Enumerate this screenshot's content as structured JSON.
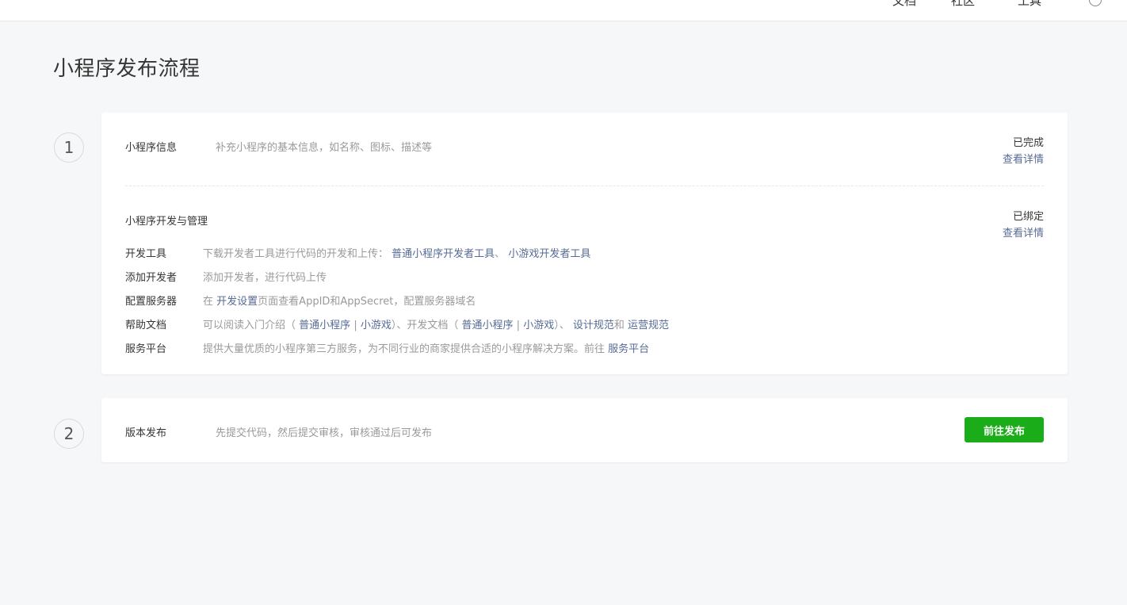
{
  "topbar": {
    "docs": "文档",
    "community": "社区",
    "tools": "工具"
  },
  "page_title": "小程序发布流程",
  "step1": {
    "number": "1",
    "info": {
      "title": "小程序信息",
      "desc": "补充小程序的基本信息，如名称、图标、描述等",
      "status": "已完成",
      "link": "查看详情"
    },
    "dev": {
      "title": "小程序开发与管理",
      "status": "已绑定",
      "link": "查看详情",
      "rows": {
        "tools": {
          "label": "开发工具",
          "desc": "下载开发者工具进行代码的开发和上传：",
          "link1": "普通小程序开发者工具",
          "sep": "、",
          "link2": "小游戏开发者工具"
        },
        "add_dev": {
          "label": "添加开发者",
          "desc": "添加开发者，进行代码上传"
        },
        "server": {
          "label": "配置服务器",
          "pre": "在",
          "link": "开发设置",
          "post": "页面查看AppID和AppSecret，配置服务器域名"
        },
        "help": {
          "label": "帮助文档",
          "pre": "可以阅读入门介绍（",
          "link1": "普通小程序",
          "bar1": "|",
          "link2": "小游戏",
          "mid": "）、开发文档（",
          "link3": "普通小程序",
          "bar2": "|",
          "link4": "小游戏",
          "mid2": "）、",
          "link5": "设计规范",
          "and": "和",
          "link6": "运营规范"
        },
        "service": {
          "label": "服务平台",
          "desc": "提供大量优质的小程序第三方服务，为不同行业的商家提供合适的小程序解决方案。前往",
          "link": "服务平台"
        }
      }
    }
  },
  "step2": {
    "number": "2",
    "title": "版本发布",
    "desc": "先提交代码，然后提交审核，审核通过后可发布",
    "button": "前往发布"
  }
}
